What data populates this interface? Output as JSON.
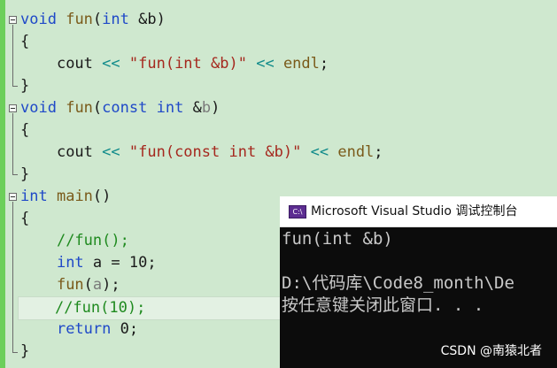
{
  "editor": {
    "fn1_sig": {
      "kw": "void",
      "name": "fun",
      "open": "(",
      "kw2": "int",
      "param": " &b",
      "close": ")"
    },
    "fn1_body": {
      "ident": "cout",
      "op1": "<<",
      "str": "\"fun(int &b)\"",
      "op2": "<<",
      "endl": "endl",
      "semi": ";"
    },
    "fn2_sig": {
      "kw": "void",
      "name": "fun",
      "open": "(",
      "kw2": "const",
      "kw3": "int",
      "param": " &",
      "pname": "b",
      "close": ")"
    },
    "fn2_body": {
      "ident": "cout",
      "op1": "<<",
      "str": "\"fun(const int &b)\"",
      "op2": "<<",
      "endl": "endl",
      "semi": ";"
    },
    "main_sig": {
      "kw": "int",
      "name": "main",
      "parens": "()"
    },
    "main_body": {
      "comment1": "//fun();",
      "decl_kw": "int",
      "decl_rest": " a = 10;",
      "call_name": "fun",
      "call_open": "(",
      "call_arg": "a",
      "call_close": ");",
      "comment2": "//fun(10);",
      "ret_kw": "return",
      "ret_rest": " 0;"
    },
    "brace_open": "{",
    "brace_close": "}"
  },
  "console": {
    "title": "Microsoft Visual Studio 调试控制台",
    "icon_text": "C:\\",
    "line1": "fun(int &b)",
    "line2": "",
    "line3": "D:\\代码库\\Code8_month\\De",
    "line4": "按任意键关闭此窗口. . ."
  },
  "watermark": "CSDN @南猿北者",
  "colors": {
    "keyword": "#1f49c8",
    "function": "#7a5a1a",
    "string": "#a5281e",
    "operator": "#0f8a8a",
    "comment": "#1f8a1f",
    "background": "#cfe8cf"
  }
}
